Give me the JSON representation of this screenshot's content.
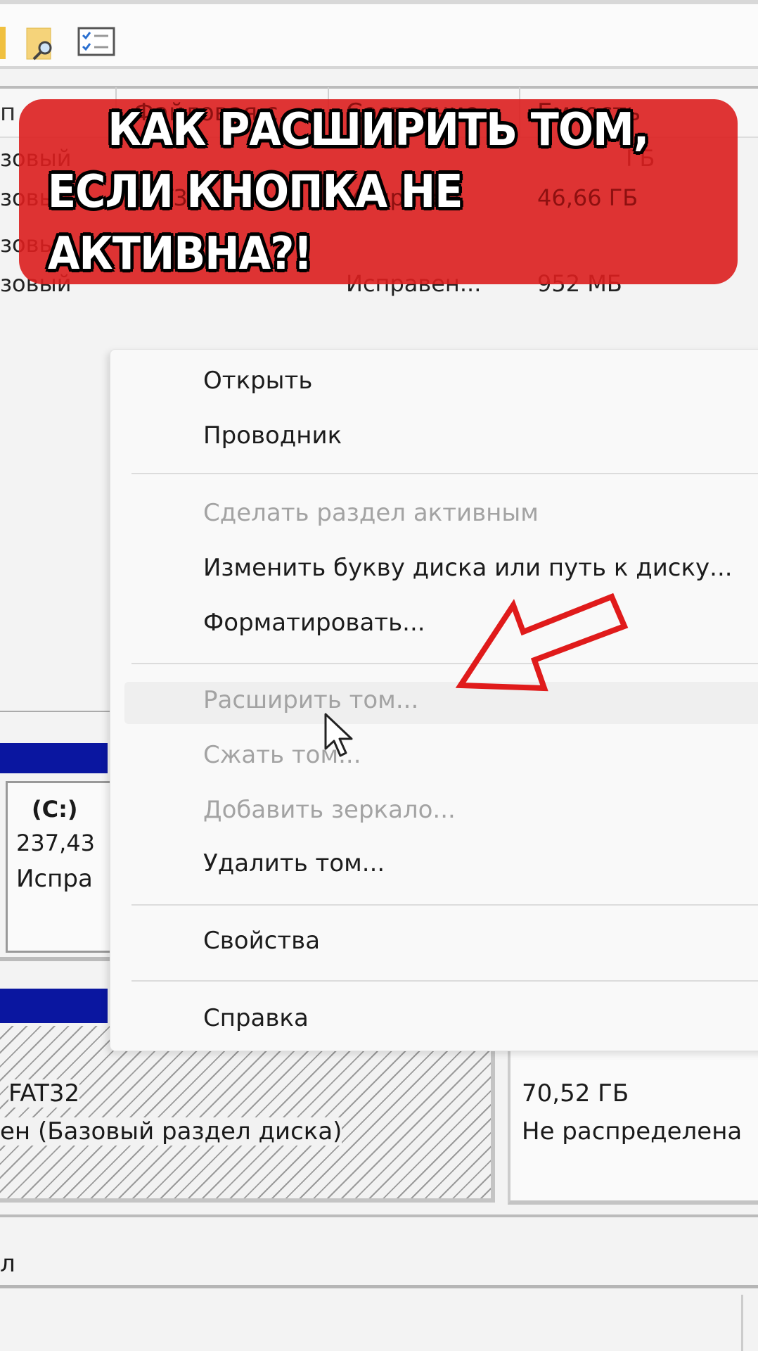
{
  "toolbar": {
    "icons": [
      "folder-search-icon",
      "checklist-icon"
    ]
  },
  "table": {
    "headers": [
      "п",
      "Файловая с...",
      "Состояние",
      "Емкость"
    ],
    "rows": [
      {
        "type": "зовый",
        "fs": "",
        "status": "",
        "capacity": "ГБ"
      },
      {
        "type": "зовый",
        "fs": "FAT32",
        "status": "Исправен",
        "capacity": "46,66 ГБ"
      },
      {
        "type": "зовый",
        "fs": "",
        "status": "",
        "capacity": ""
      },
      {
        "type": "зовый",
        "fs": "",
        "status": "Исправен...",
        "capacity": "952 МБ"
      }
    ]
  },
  "banner": {
    "line1": "КАК РАСШИРИТЬ ТОМ,",
    "line2": "ЕСЛИ КНОПКА НЕ АКТИВНА?!",
    "color": "#dc1e1e"
  },
  "context_menu": {
    "items": [
      {
        "label": "Открыть",
        "enabled": true
      },
      {
        "label": "Проводник",
        "enabled": true
      },
      {
        "label": "Сделать раздел активным",
        "enabled": false
      },
      {
        "label": "Изменить букву диска или путь к диску...",
        "enabled": true
      },
      {
        "label": "Форматировать...",
        "enabled": true
      },
      {
        "label": "Расширить том...",
        "enabled": false
      },
      {
        "label": "Сжать том...",
        "enabled": false
      },
      {
        "label": "Добавить зеркало...",
        "enabled": false
      },
      {
        "label": "Удалить том...",
        "enabled": true
      },
      {
        "label": "Свойства",
        "enabled": true
      },
      {
        "label": "Справка",
        "enabled": true
      }
    ]
  },
  "disk": {
    "c_label": "(C:)",
    "c_size": "237,43",
    "c_status": "Испра",
    "fat_fs": "FAT32",
    "fat_status": "ен (Базовый раздел диска)",
    "unalloc_size": "70,52 ГБ",
    "unalloc_status": "Не распределена"
  },
  "legend": {
    "text": "л"
  },
  "annotation": {
    "arrow_color": "#e01b1b"
  }
}
